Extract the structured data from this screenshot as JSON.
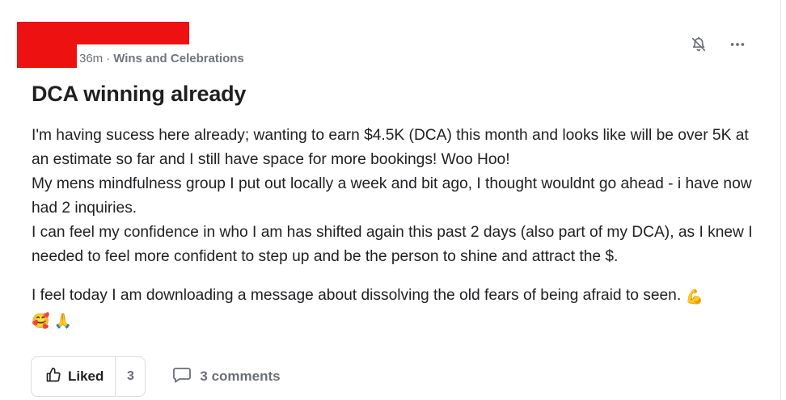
{
  "post": {
    "timestamp": "36m",
    "separator": "·",
    "category": "Wins and Celebrations",
    "title": "DCA winning already",
    "body": {
      "line1": "I'm having sucess here already; wanting to earn $4.5K (DCA) this month and looks like will be over 5K at an estimate so far and I still have space for more bookings! Woo Hoo!",
      "line2": "My mens mindfulness group I put out locally a week and bit ago, I thought wouldnt go ahead - i have now had 2 inquiries.",
      "line3": "I can feel my confidence in who I am has shifted again this past 2 days (also part of my DCA), as I knew I needed to feel more confident to step up and be the person to shine and attract the $.",
      "line4": "I feel today I am downloading a message about dissolving the old fears of being afraid to seen."
    },
    "emojis": {
      "flexed_biceps": "💪",
      "smiling_face_with_hearts": "🥰",
      "folded_hands": "🙏"
    }
  },
  "icons": {
    "mute_notifications": "bell-off-icon",
    "more_options": "more-horizontal-icon",
    "like": "thumbs-up-icon",
    "comment": "comment-icon"
  },
  "footer": {
    "like_label": "Liked",
    "like_count": "3",
    "comments_label": "3 comments"
  },
  "colors": {
    "redaction": "#ee1111",
    "muted_text": "#6b6f76",
    "title_text": "#1f1f1f",
    "border": "#dadce0"
  }
}
